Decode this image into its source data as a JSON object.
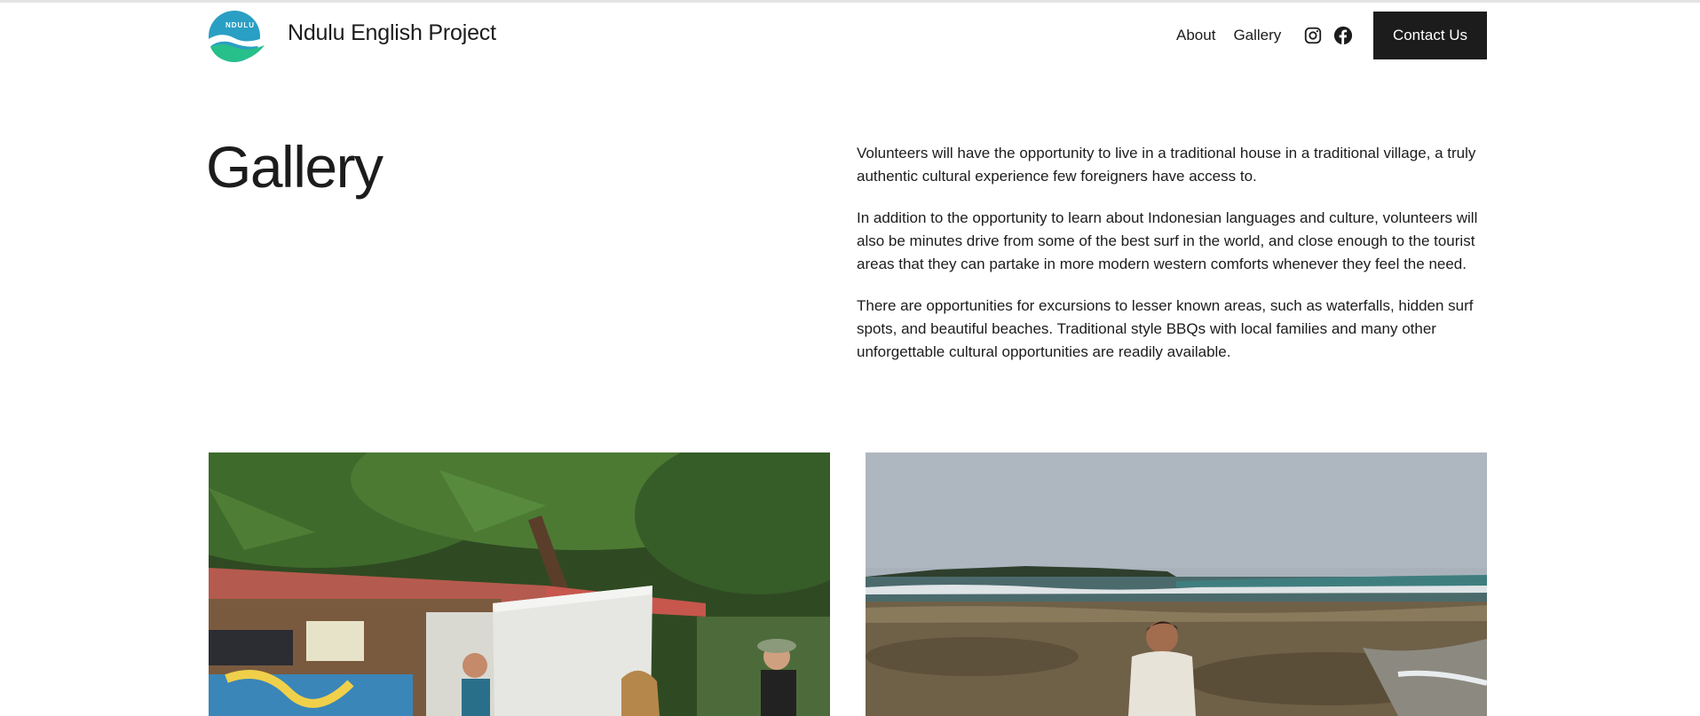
{
  "header": {
    "logo_text": "NDULU",
    "site_title": "Ndulu English Project",
    "nav": [
      {
        "label": "About"
      },
      {
        "label": "Gallery"
      }
    ],
    "social_icons": [
      "instagram-icon",
      "facebook-icon"
    ],
    "contact_label": "Contact Us"
  },
  "page": {
    "title": "Gallery",
    "paragraphs": [
      "Volunteers will have the opportunity to live in a traditional house in a traditional village, a truly authentic cultural experience few foreigners have access to.",
      "In addition to the opportunity to learn about Indonesian languages and culture, volunteers will also be minutes drive from some of the best surf in the world, and close enough to the tourist areas that they can partake in more modern western comforts whenever they feel the need.",
      "There are opportunities for excursions to lesser known areas, such as waterfalls, hidden surf spots, and beautiful beaches. Traditional style BBQs with local families and many other unforgettable cultural opportunities are readily available."
    ]
  },
  "gallery": {
    "photos": [
      {
        "name": "classroom-under-trees-photo"
      },
      {
        "name": "beach-surf-photo"
      }
    ]
  },
  "colors": {
    "text": "#1c1c1c",
    "button_bg": "#1c1c1c",
    "logo_blue": "#2a9fc4",
    "logo_green": "#27c08a"
  }
}
